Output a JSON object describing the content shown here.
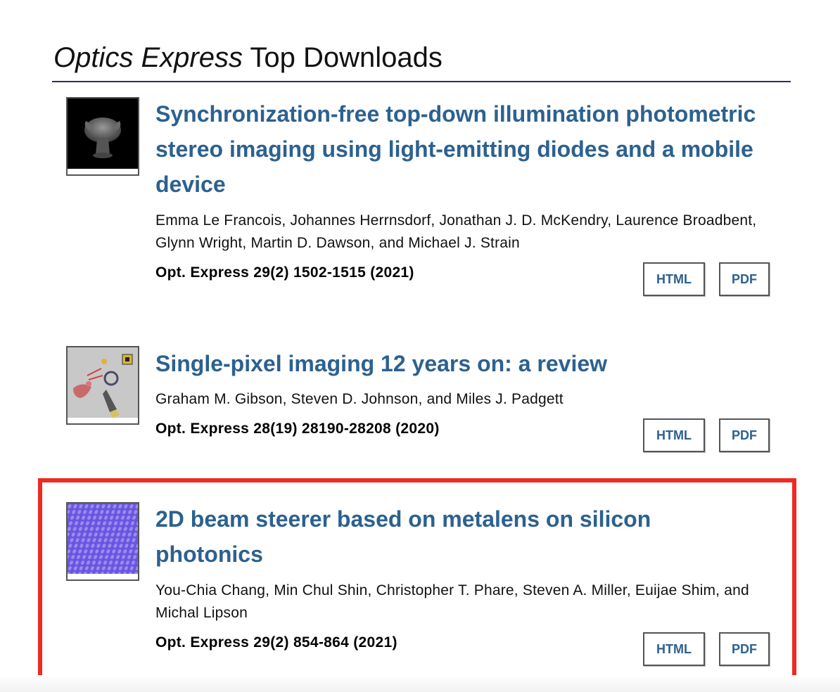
{
  "header": {
    "journal": "Optics Express",
    "suffix": " Top Downloads"
  },
  "articles": [
    {
      "title": "Synchronization-free top-down illumination photometric stereo imaging using light-emitting diodes and a mobile device",
      "authors": "Emma Le Francois, Johannes Herrnsdorf, Jonathan J. D. McKendry, Laurence Broadbent, Glynn Wright, Martin D. Dawson, and Michael J. Strain",
      "citation": "Opt. Express 29(2) 1502-1515 (2021)",
      "html_label": "HTML",
      "pdf_label": "PDF",
      "thumbnail": "3d-reconstruction-thumbnail"
    },
    {
      "title": "Single-pixel imaging 12 years on: a review",
      "authors": "Graham M. Gibson, Steven D. Johnson, and Miles J. Padgett",
      "citation": "Opt. Express 28(19) 28190-28208 (2020)",
      "html_label": "HTML",
      "pdf_label": "PDF",
      "thumbnail": "single-pixel-imaging-thumbnail"
    },
    {
      "title": "2D beam steerer based on metalens on silicon photonics",
      "authors": "You-Chia Chang, Min Chul Shin, Christopher T. Phare, Steven A. Miller, Euijae Shim, and Michal Lipson",
      "citation": "Opt. Express 29(2) 854-864 (2021)",
      "html_label": "HTML",
      "pdf_label": "PDF",
      "thumbnail": "metalens-thumbnail"
    }
  ],
  "colors": {
    "link": "#2c6190",
    "rule": "#27305c",
    "highlight": "#ee2a22"
  }
}
